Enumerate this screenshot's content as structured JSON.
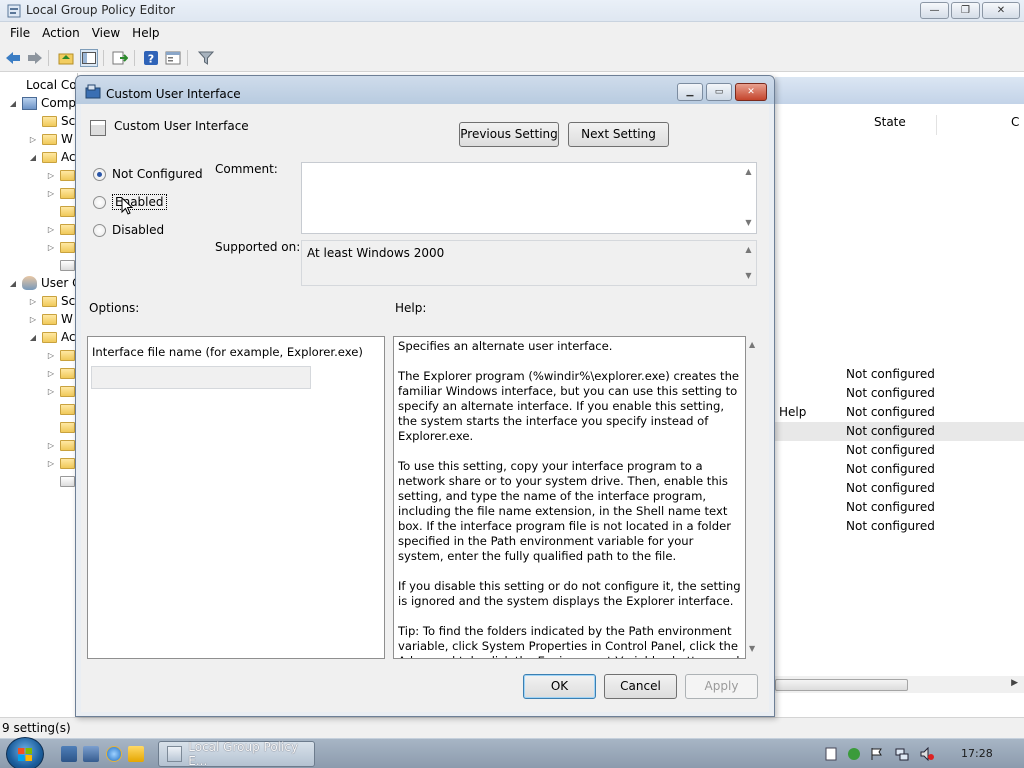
{
  "main_window": {
    "title": "Local Group Policy Editor",
    "controls": {
      "minimize": "—",
      "maximize": "❐",
      "close": "✕"
    }
  },
  "menu": [
    "File",
    "Action",
    "View",
    "Help"
  ],
  "toolbar_icons": [
    "back-icon",
    "forward-icon",
    "up-folder-icon",
    "show-hide-tree-icon",
    "export-list-icon",
    "help-icon",
    "properties-icon",
    "filter-icon"
  ],
  "tree": {
    "root_label": "Local Cor",
    "computer_label": "Comp",
    "computer_children": [
      "Sc",
      "W",
      "Ac"
    ],
    "user_label": "User C",
    "user_children": [
      "Sc",
      "W",
      "Ac"
    ]
  },
  "right_pane": {
    "columns": {
      "state": "State",
      "comment": "C"
    },
    "rows": [
      {
        "name": "",
        "state": "Not configured",
        "selected": false
      },
      {
        "name": "",
        "state": "Not configured",
        "selected": false
      },
      {
        "name": "Help",
        "state": "Not configured",
        "selected": false
      },
      {
        "name": "",
        "state": "Not configured",
        "selected": true
      },
      {
        "name": "",
        "state": "Not configured",
        "selected": false
      },
      {
        "name": "",
        "state": "Not configured",
        "selected": false
      },
      {
        "name": "",
        "state": "Not configured",
        "selected": false
      },
      {
        "name": "",
        "state": "Not configured",
        "selected": false
      },
      {
        "name": "",
        "state": "Not configured",
        "selected": false
      }
    ]
  },
  "status_bar": {
    "text": "9 setting(s)"
  },
  "dialog": {
    "title": "Custom User Interface",
    "setting_name": "Custom User Interface",
    "previous_setting": "Previous Setting",
    "next_setting": "Next Setting",
    "radio": {
      "not_configured": "Not Configured",
      "enabled": "Enabled",
      "disabled": "Disabled",
      "selected": "not_configured"
    },
    "comment_label": "Comment:",
    "comment_value": "",
    "supported_on_label": "Supported on:",
    "supported_on_value": "At least Windows 2000",
    "options_label": "Options:",
    "help_label": "Help:",
    "option_field_label": "Interface file name (for example, Explorer.exe)",
    "option_field_value": "",
    "help_paragraphs": [
      "Specifies an alternate user interface.",
      "The Explorer program (%windir%\\explorer.exe) creates the familiar Windows interface, but you can use this setting to specify an alternate interface. If you enable this setting, the system starts the interface you specify instead of Explorer.exe.",
      "To use this setting, copy your interface program to a network share or to your system drive. Then, enable this setting, and type the name of the interface program, including the file name extension, in the Shell name text box. If the interface program file is not located in a folder specified in the Path environment variable for your system, enter the fully qualified path to the file.",
      "If you disable this setting or do not configure it, the setting is ignored and the system displays the Explorer interface.",
      "Tip: To find the folders indicated by the Path environment variable, click System Properties in Control Panel, click the Advanced tab, click the Environment Variables button, and then, in the System variables box, click Path."
    ],
    "ok": "OK",
    "cancel": "Cancel",
    "apply": "Apply"
  },
  "taskbar": {
    "task_button": "Local Group Policy E...",
    "clock": "17:28",
    "tray_icons": [
      "action-center-icon",
      "security-icon",
      "flag-icon",
      "network-icon",
      "volume-muted-icon"
    ]
  },
  "colors": {
    "accent": "#2a56a8",
    "selection": "#e8e8e8",
    "dialog_bg": "#f0f0f0"
  }
}
